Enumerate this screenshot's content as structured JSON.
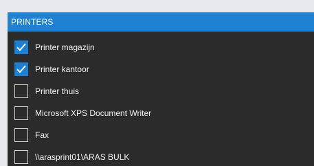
{
  "panel": {
    "title": "PRINTERS"
  },
  "printers": [
    {
      "label": "Printer magazijn",
      "checked": true
    },
    {
      "label": "Printer kantoor",
      "checked": true
    },
    {
      "label": "Printer thuis",
      "checked": false
    },
    {
      "label": "Microsoft XPS Document Writer",
      "checked": false
    },
    {
      "label": "Fax",
      "checked": false
    },
    {
      "label": "\\\\arasprint01\\ARAS BULK",
      "checked": false
    }
  ],
  "colors": {
    "header": "#1e81d2",
    "panel_background": "#2b2b2b",
    "check_accent": "#1b7fd6",
    "page_background": "#e7e9ec"
  },
  "icons": {
    "checkbox_checked": "checkmark-icon"
  }
}
